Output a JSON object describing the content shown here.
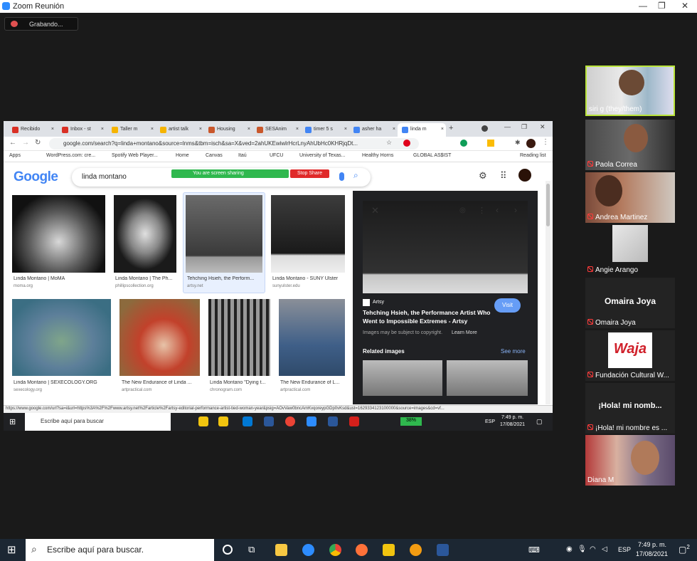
{
  "zoom": {
    "title": "Zoom Reunión",
    "recording": "Grabando..."
  },
  "browser": {
    "tabs": [
      {
        "label": "Recibido",
        "color": "#d93025"
      },
      {
        "label": "Inbox - st",
        "color": "#d93025"
      },
      {
        "label": "Taller m",
        "color": "#f6b400"
      },
      {
        "label": "artist talk",
        "color": "#f6b400"
      },
      {
        "label": "Housing",
        "color": "#c9572b"
      },
      {
        "label": "SESAnim",
        "color": "#c9572b"
      },
      {
        "label": "timer 5 s",
        "color": "#4285f4"
      },
      {
        "label": "asher ha",
        "color": "#4285f4"
      },
      {
        "label": "linda m",
        "color": "#4285f4"
      }
    ],
    "url": "google.com/search?q=linda+montano&source=lnms&tbm=isch&sa=X&ved=2ahUKEwiwlrHcrLnyAhUbHc0KHRjqDt...",
    "bookmarks": [
      "Apps",
      "WordPress.com: cre...",
      "Spotify Web Player...",
      "Home",
      "Canvas",
      "Itaú",
      "UFCU",
      "University of Texas...",
      "Healthy Horns",
      "GLOBAL AS$IST",
      "Reading list"
    ]
  },
  "google": {
    "logo": "Google",
    "query": "linda montano",
    "sharing": "You are screen sharing",
    "stop": "Stop Share",
    "results": [
      {
        "caption": "Linda Montano | MoMA",
        "source": "moma.org"
      },
      {
        "caption": "Linda Montano | The Ph...",
        "source": "phillipscollection.org"
      },
      {
        "caption": "Tehching Hsieh, the Perform...",
        "source": "artsy.net"
      },
      {
        "caption": "Linda Montano - SUNY Ulster",
        "source": "sunyulster.edu"
      },
      {
        "caption": "Linda Montano | SEXECOLOGY.ORG",
        "source": "sexecology.org"
      },
      {
        "caption": "The New Endurance of Linda ...",
        "source": "artpractical.com"
      },
      {
        "caption": "Linda Montano \"Dying t...",
        "source": "chronogram.com"
      },
      {
        "caption": "The New Endurance of L...",
        "source": "artpractical.com"
      }
    ],
    "panel": {
      "site": "Artsy",
      "title": "Tehching Hsieh, the Performance Artist Who Went to Impossible Extremes - Artsy",
      "copyright": "Images may be subject to copyright.",
      "learn": "Learn More",
      "visit": "Visit",
      "related": "Related images",
      "see_more": "See more"
    },
    "status_url": "https://www.google.com/url?sa=i&url=https%3A%2F%2Fwww.artsy.net%2Farticle%2Fartsy-editorial-performance-artist-tied-woman-year&psig=AOvVaw0bncAmKvqoreypGDp0vKsd&ust=1629334123100000&source=images&cd=vf..."
  },
  "inner_taskbar": {
    "search": "Escribe aquí para buscar",
    "battery": "38%",
    "lang": "ESP",
    "time": "7:49 p. m.",
    "date": "17/08/2021"
  },
  "participants": [
    {
      "name": "siri g (they/them)",
      "muted": false
    },
    {
      "name": "Paola Correa",
      "muted": true
    },
    {
      "name": "Andrea Martinez",
      "muted": true
    },
    {
      "name": "Angie Arango",
      "muted": true
    },
    {
      "name": "Omaira Joya",
      "muted": true,
      "big": "Omaira Joya"
    },
    {
      "name": "Fundación Cultural W...",
      "muted": true,
      "logo": "Waja"
    },
    {
      "name": "¡Hola! mi nombre es ...",
      "muted": true,
      "big": "¡Hola! mi nomb..."
    },
    {
      "name": "Diana M",
      "muted": false
    }
  ],
  "taskbar": {
    "search": "Escribe aquí para buscar.",
    "lang": "ESP",
    "time": "7:49 p. m.",
    "date": "17/08/2021",
    "notifications": "2"
  }
}
